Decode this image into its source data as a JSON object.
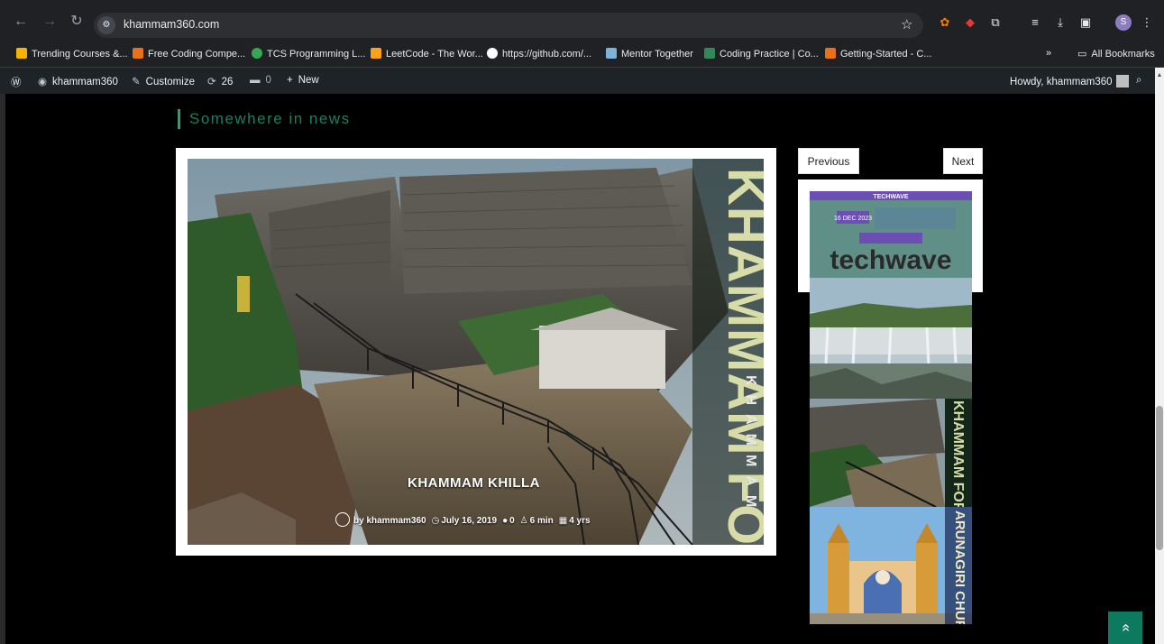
{
  "browser": {
    "url": "khammam360.com",
    "profile_initial": "S",
    "bookmarks": [
      {
        "label": "Trending Courses &...",
        "color": "#f4b400"
      },
      {
        "label": "Free Coding Compe...",
        "color": "#e8711a"
      },
      {
        "label": "TCS Programming L...",
        "color": "#34a853"
      },
      {
        "label": "LeetCode - The Wor...",
        "color": "#ffa116"
      },
      {
        "label": "https://github.com/...",
        "color": "#ffffff"
      },
      {
        "label": "Mentor Together",
        "color": "#7fb3d5"
      },
      {
        "label": "Coding Practice | Co...",
        "color": "#2e8b57"
      },
      {
        "label": "Getting-Started - C...",
        "color": "#e8711a"
      }
    ],
    "more_label": "»",
    "all_bookmarks": "All Bookmarks"
  },
  "adminbar": {
    "site_name": "khammam360",
    "customize": "Customize",
    "updates": "26",
    "comments": "0",
    "new_label": "New",
    "howdy": "Howdy, khammam360"
  },
  "section": {
    "title": "Somewhere in news"
  },
  "featured": {
    "title": "KHAMMAM KHILLA",
    "author": "by khammam360",
    "date": "July 16, 2019",
    "comments": "0",
    "read_time": "6 min",
    "age": "4 yrs",
    "image_text": "KHAMMAM FORT",
    "image_subtext": "KHAMMAM"
  },
  "nav": {
    "previous": "Previous",
    "next": "Next"
  },
  "thumbs": {
    "t1_brand": "techwave",
    "t1_date": "16 DEC 2023",
    "t1_header": "TECHWAVE",
    "t4_text": "ARUNAGIRI CHURCH"
  },
  "back_to_top": "«"
}
